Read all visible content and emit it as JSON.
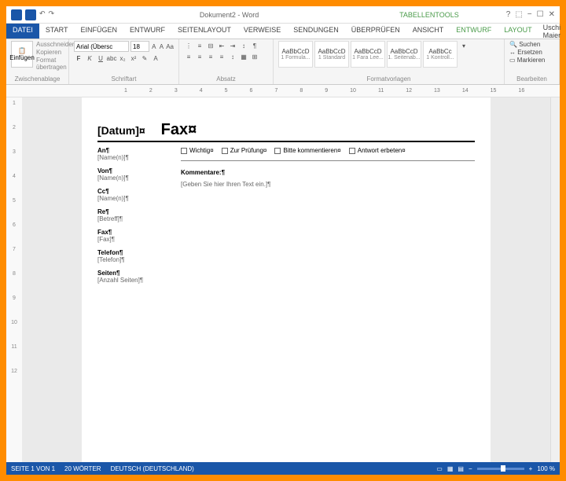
{
  "title": "Dokument2 - Word",
  "contextualTab": "TABELLENTOOLS",
  "user": "Uschi Maier",
  "tabs": {
    "file": "DATEI",
    "start": "START",
    "einf": "EINFÜGEN",
    "entwurf": "ENTWURF",
    "layout": "SEITENLAYOUT",
    "verweise": "VERWEISE",
    "send": "SENDUNGEN",
    "ueber": "ÜBERPRÜFEN",
    "ansicht": "ANSICHT",
    "ctx1": "ENTWURF",
    "ctx2": "LAYOUT"
  },
  "clipboard": {
    "paste": "Einfügen",
    "cut": "Ausschneiden",
    "copy": "Kopieren",
    "format": "Format übertragen",
    "label": "Zwischenablage"
  },
  "font": {
    "name": "Arial (Übersc",
    "size": "18",
    "label": "Schriftart"
  },
  "para": {
    "label": "Absatz"
  },
  "styles": {
    "s1": "AaBbCcD",
    "s2": "AaBbCcD",
    "s3": "AaBbCcD",
    "s4": "AaBbCcD",
    "s5": "AaBbCc",
    "n1": "1 Formula...",
    "n2": "1 Standard",
    "n3": "1 Fara Lee...",
    "n4": "1. Seitenab...",
    "n5": "1 Kontroll...",
    "label": "Formatvorlagen"
  },
  "editing": {
    "find": "Suchen",
    "replace": "Ersetzen",
    "select": "Markieren",
    "label": "Bearbeiten"
  },
  "ruler": [
    "1",
    "2",
    "3",
    "4",
    "5",
    "6",
    "7",
    "8",
    "9",
    "10",
    "11",
    "12",
    "13",
    "14",
    "15",
    "16"
  ],
  "vruler": [
    "1",
    "2",
    "3",
    "4",
    "5",
    "6",
    "7",
    "8",
    "9",
    "10",
    "11",
    "12"
  ],
  "doc": {
    "datum": "[Datum]¤",
    "fax": "Fax¤",
    "fields": [
      {
        "lbl": "An¶",
        "val": "[Name(n)]¶"
      },
      {
        "lbl": "Von¶",
        "val": "[Name(n)]¶"
      },
      {
        "lbl": "Cc¶",
        "val": "[Name(n)]¶"
      },
      {
        "lbl": "Re¶",
        "val": "[Betreff]¶"
      },
      {
        "lbl": "Fax¶",
        "val": "[Fax]¶"
      },
      {
        "lbl": "Telefon¶",
        "val": "[Telefon]¶"
      },
      {
        "lbl": "Seiten¶",
        "val": "[Anzahl Seiten]¶"
      }
    ],
    "checks": [
      "Wichtig¤",
      "Zur Prüfung¤",
      "Bitte kommentieren¤",
      "Antwort erbeten¤"
    ],
    "kommLabel": "Kommentare:¶",
    "kommText": "[Geben Sie hier Ihren Text ein.]¶"
  },
  "status": {
    "page": "SEITE 1 VON 1",
    "words": "20 WÖRTER",
    "lang": "DEUTSCH (DEUTSCHLAND)",
    "zoom": "100 %"
  }
}
